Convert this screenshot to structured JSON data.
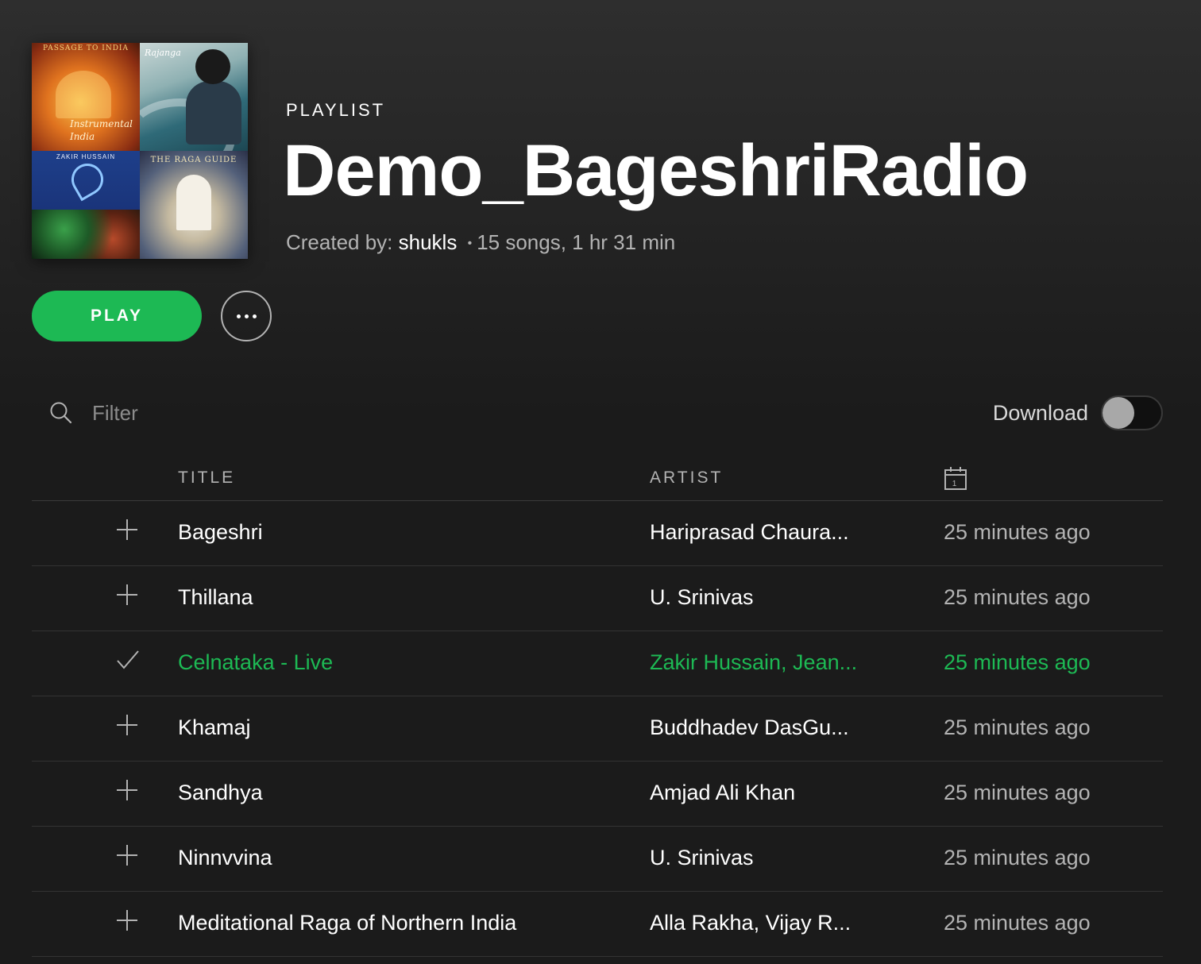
{
  "header": {
    "type_label": "PLAYLIST",
    "title": "Demo_BageshriRadio",
    "created_by_label": "Created by:",
    "owner": "shukls",
    "separator": "•",
    "summary": "15 songs, 1 hr 31 min"
  },
  "cover": {
    "tile1_top": "PASSAGE TO INDIA",
    "tile1_main": "Instrumental India",
    "tile2_script": "Rajanga",
    "tile3_name": "ZAKIR HUSSAIN",
    "tile4_title": "THE RAGA GUIDE"
  },
  "actions": {
    "play_label": "PLAY",
    "more_icon": "ellipsis-icon"
  },
  "filter": {
    "placeholder": "Filter",
    "value": ""
  },
  "download": {
    "label": "Download",
    "enabled": false
  },
  "columns": {
    "title": "TITLE",
    "artist": "ARTIST",
    "date_icon": "calendar-icon",
    "date_icon_text": "1"
  },
  "tracks": [
    {
      "title": "Bageshri",
      "artist": "Hariprasad Chaura...",
      "added": "25 minutes ago",
      "saved": false
    },
    {
      "title": "Thillana",
      "artist": "U. Srinivas",
      "added": "25 minutes ago",
      "saved": false
    },
    {
      "title": "Celnataka - Live",
      "artist": "Zakir Hussain, Jean...",
      "added": "25 minutes ago",
      "saved": true
    },
    {
      "title": "Khamaj",
      "artist": "Buddhadev DasGu...",
      "added": "25 minutes ago",
      "saved": false
    },
    {
      "title": "Sandhya",
      "artist": "Amjad Ali Khan",
      "added": "25 minutes ago",
      "saved": false
    },
    {
      "title": "Ninnvvina",
      "artist": "U. Srinivas",
      "added": "25 minutes ago",
      "saved": false
    },
    {
      "title": "Meditational Raga of Northern India",
      "artist": "Alla Rakha, Vijay R...",
      "added": "25 minutes ago",
      "saved": false
    }
  ],
  "colors": {
    "accent": "#1db954",
    "background": "#1b1b1b",
    "muted_text": "#b3b3b3"
  }
}
